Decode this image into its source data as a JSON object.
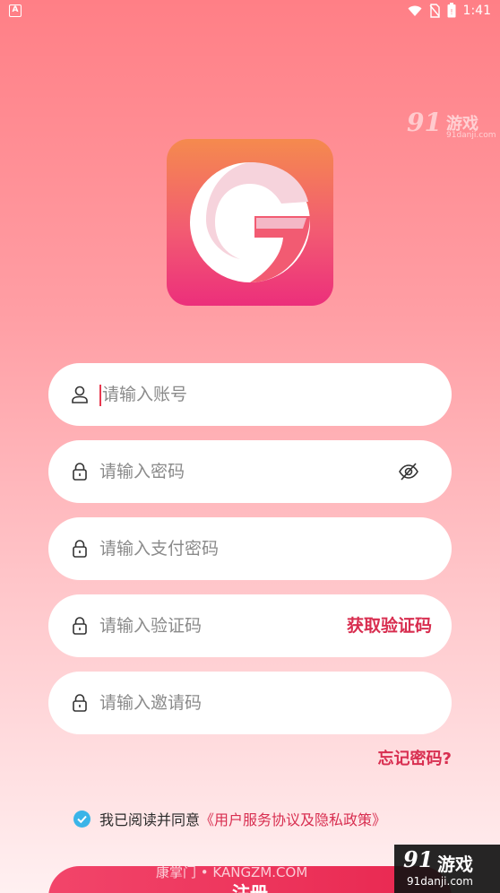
{
  "status_bar": {
    "app_indicator": "A",
    "time": "1:41",
    "icons": [
      "wifi-icon",
      "no-sim-icon",
      "battery-icon"
    ]
  },
  "watermark_top": {
    "brand_num": "91",
    "brand_name": "游戏",
    "url": "91danji.com"
  },
  "logo": {
    "letter_icon": "g-logo-icon"
  },
  "form": {
    "account_placeholder": "请输入账号",
    "password_placeholder": "请输入密码",
    "pay_password_placeholder": "请输入支付密码",
    "verify_code_placeholder": "请输入验证码",
    "get_code_label": "获取验证码",
    "invite_code_placeholder": "请输入邀请码"
  },
  "forgot_password": "忘记密码?",
  "agreement": {
    "text": "我已阅读并同意",
    "link": "《用户服务协议及隐私政策》",
    "checked": true
  },
  "register_button": "注册",
  "watermark_bottom": {
    "site_text": "康掌门 • KANGZM.COM",
    "brand_num": "91",
    "brand_name": "游戏",
    "url": "91danji.com"
  },
  "colors": {
    "accent": "#d82e50",
    "check": "#3ab4e8",
    "field_bg": "#ffffff"
  }
}
